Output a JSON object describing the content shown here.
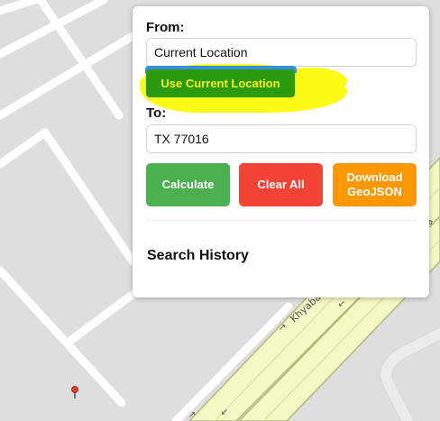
{
  "map": {
    "street_name": "Khyaba",
    "colors": {
      "background": "#dedede",
      "road": "#ffffff",
      "highway": "#f5f7c4",
      "highway_edge": "#b3ba7a",
      "marker": "#e2421f"
    }
  },
  "panel": {
    "from_label": "From:",
    "from_value": "Current Location",
    "use_location_label": "Use Current Location",
    "to_label": "To:",
    "to_value": "TX 77016",
    "calculate_label": "Calculate",
    "clear_label": "Clear All",
    "download_label": "Download GeoJSON",
    "history_title": "Search History"
  },
  "colors": {
    "calculate": "#4caf50",
    "clear": "#f44336",
    "download": "#ff9800",
    "use_location_bg": "#2c9a0e",
    "use_location_text": "#f4f21a",
    "highlight": "#fbfb16"
  }
}
